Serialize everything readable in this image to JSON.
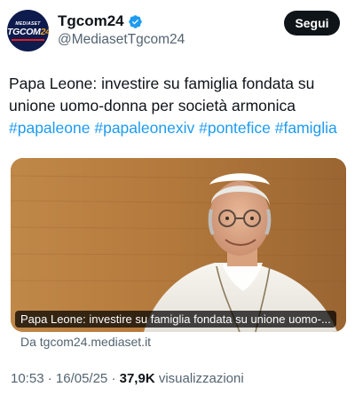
{
  "account": {
    "name": "Tgcom24",
    "handle": "@MediasetTgcom24",
    "avatar_top": "MEDIASET",
    "avatar_main_a": "TGCOM",
    "avatar_main_b": "24",
    "verified": true
  },
  "follow_label": "Segui",
  "tweet": {
    "line1": "Papa Leone: investire su famiglia fondata su",
    "line2": "unione uomo-donna per società armonica",
    "hashtags": [
      "#papaleone",
      "#papaleonexiv",
      "#pontefice",
      "#famiglia"
    ]
  },
  "media": {
    "caption": "Papa Leone: investire su famiglia fondata su unione uomo-..."
  },
  "source": "Da tgcom24.mediaset.it",
  "meta": {
    "time": "10:53",
    "date": "16/05/25",
    "views_count": "37,9K",
    "views_label": "visualizzazioni"
  },
  "colors": {
    "accent": "#1d9bf0",
    "follow_bg": "#0f1419",
    "secondary_text": "#536471"
  }
}
